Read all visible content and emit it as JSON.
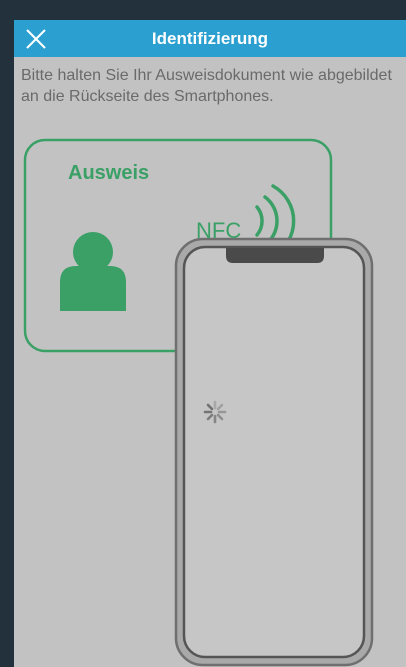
{
  "header": {
    "title": "Identifizierung",
    "close_icon": "close-icon"
  },
  "instruction": "Bitte halten Sie Ihr Ausweisdokument wie abgebildet an die Rückseite des Smartphones.",
  "illustration": {
    "id_card_title": "Ausweis",
    "nfc_label": "NFC",
    "person_icon": "person-icon",
    "nfc_icon": "nfc-waves-icon",
    "phone_icon": "smartphone-icon",
    "spinner_icon": "loading-spinner-icon"
  },
  "colors": {
    "header_bg": "#2b9fd0",
    "accent_green": "#3aa066",
    "sheet_bg": "#c2c2c2",
    "frame_bg": "#23313c"
  }
}
